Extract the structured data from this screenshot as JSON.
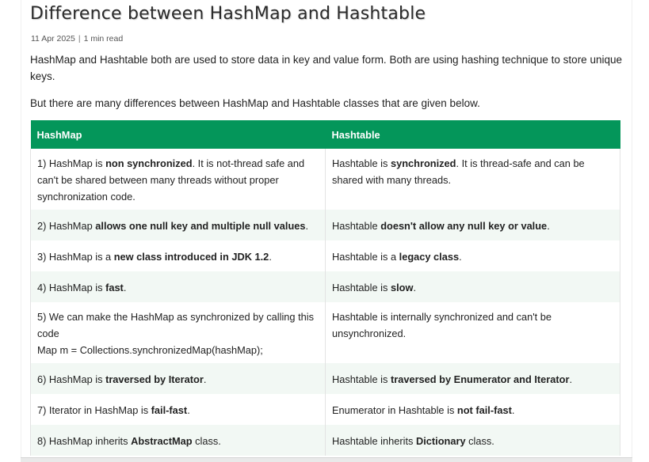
{
  "article": {
    "title": "Difference between HashMap and Hashtable",
    "date": "11 Apr 2025",
    "separator": "|",
    "read_time": "1 min read",
    "intro": "HashMap and Hashtable both are used to store data in key and value form. Both are using hashing technique to store unique keys.",
    "intro2": "But there are many differences between HashMap and Hashtable classes that are given below."
  },
  "table": {
    "headers": [
      "HashMap",
      "Hashtable"
    ],
    "rows": [
      {
        "left": [
          "1) HashMap is ",
          "non synchronized",
          ". It is not-thread safe and can't be shared between many threads without proper synchronization code."
        ],
        "right": [
          "Hashtable is ",
          "synchronized",
          ". It is thread-safe and can be shared with many threads."
        ]
      },
      {
        "left": [
          "2) HashMap ",
          "allows one null key and multiple null values",
          "."
        ],
        "right": [
          "Hashtable ",
          "doesn't allow any null key or value",
          "."
        ]
      },
      {
        "left": [
          "3) HashMap is a ",
          "new class introduced in JDK 1.2",
          "."
        ],
        "right": [
          "Hashtable is a ",
          "legacy class",
          "."
        ]
      },
      {
        "left": [
          "4) HashMap is ",
          "fast",
          "."
        ],
        "right": [
          "Hashtable is ",
          "slow",
          "."
        ]
      },
      {
        "left_line1": "5) We can make the HashMap as synchronized by calling this code",
        "left_line2": "Map m = Collections.synchronizedMap(hashMap);",
        "right_plain": "Hashtable is internally synchronized and can't be unsynchronized."
      },
      {
        "left": [
          "6) HashMap is ",
          "traversed by Iterator",
          "."
        ],
        "right": [
          "Hashtable is ",
          "traversed by Enumerator and Iterator",
          "."
        ]
      },
      {
        "left": [
          "7) Iterator in HashMap is ",
          "fail-fast",
          "."
        ],
        "right": [
          "Enumerator in Hashtable is ",
          "not fail-fast",
          "."
        ]
      },
      {
        "left": [
          "8) HashMap inherits ",
          "AbstractMap",
          " class."
        ],
        "right": [
          "Hashtable inherits ",
          "Dictionary",
          " class."
        ]
      }
    ]
  },
  "colors": {
    "header_bg": "#04965a",
    "row_alt_bg": "#f2f8f4"
  }
}
